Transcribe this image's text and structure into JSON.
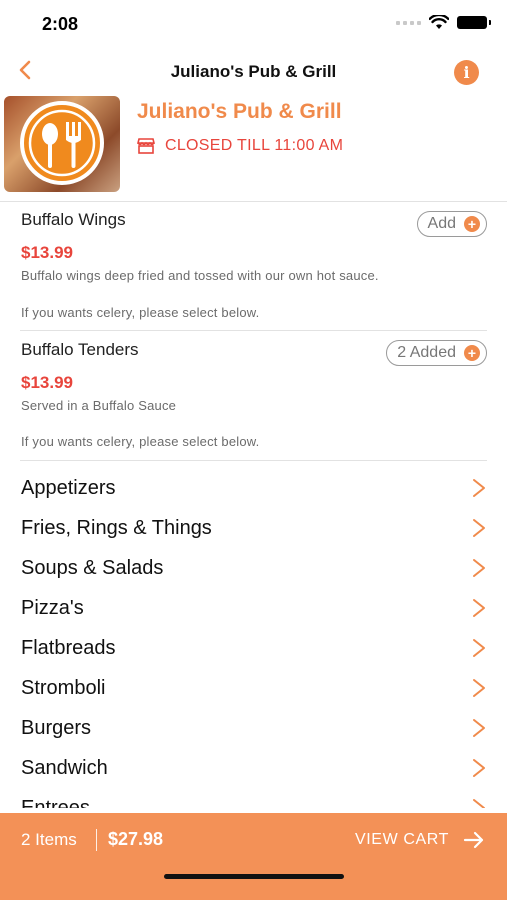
{
  "status_bar": {
    "time": "2:08"
  },
  "header": {
    "title": "Juliano's Pub & Grill",
    "info_icon": "i"
  },
  "restaurant": {
    "name": "Juliano's Pub & Grill",
    "status": "CLOSED TILL 11:00 AM"
  },
  "colors": {
    "accent": "#f08a4b",
    "price": "#e8453c",
    "cart_bar": "#f39157"
  },
  "items": [
    {
      "name": "Buffalo Wings",
      "price": "$13.99",
      "description": "Buffalo wings deep fried and tossed with our own hot sauce.",
      "note": "If you wants celery, please select below.",
      "button_label": "Add"
    },
    {
      "name": "Buffalo Tenders",
      "price": "$13.99",
      "description": "Served in a Buffalo Sauce",
      "note": "If you wants celery, please select below.",
      "button_label": "2 Added"
    }
  ],
  "categories": [
    "Appetizers",
    "Fries, Rings & Things",
    "Soups & Salads",
    "Pizza's",
    "Flatbreads",
    "Stromboli",
    "Burgers",
    "Sandwich",
    "Entrees"
  ],
  "cart": {
    "count": "2 Items",
    "total": "$27.98",
    "view_label": "VIEW CART"
  }
}
